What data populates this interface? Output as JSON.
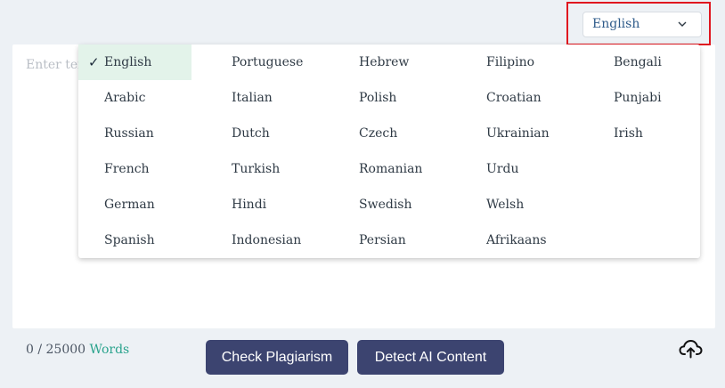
{
  "editor": {
    "placeholder": "Enter tex"
  },
  "language_select": {
    "value": "English",
    "icon": "chevron-down-icon"
  },
  "language_dropdown": {
    "selected": "English",
    "check_mark": "✓",
    "options": [
      "English",
      "Arabic",
      "Russian",
      "French",
      "German",
      "Spanish",
      "Portuguese",
      "Italian",
      "Dutch",
      "Turkish",
      "Hindi",
      "Indonesian",
      "Hebrew",
      "Polish",
      "Czech",
      "Romanian",
      "Swedish",
      "Persian",
      "Filipino",
      "Croatian",
      "Ukrainian",
      "Urdu",
      "Welsh",
      "Afrikaans",
      "Bengali",
      "Punjabi",
      "Irish"
    ]
  },
  "footer": {
    "word_count": "0 / 25000",
    "word_unit": "Words",
    "check_plagiarism_label": "Check Plagiarism",
    "detect_ai_label": "Detect AI Content",
    "upload_icon": "cloud-upload-icon"
  },
  "colors": {
    "background": "#edf1f5",
    "button": "#3c4470",
    "highlight_border": "#e0161f",
    "selected_bg": "#e3f3ea",
    "accent_text": "#2aa38d"
  }
}
